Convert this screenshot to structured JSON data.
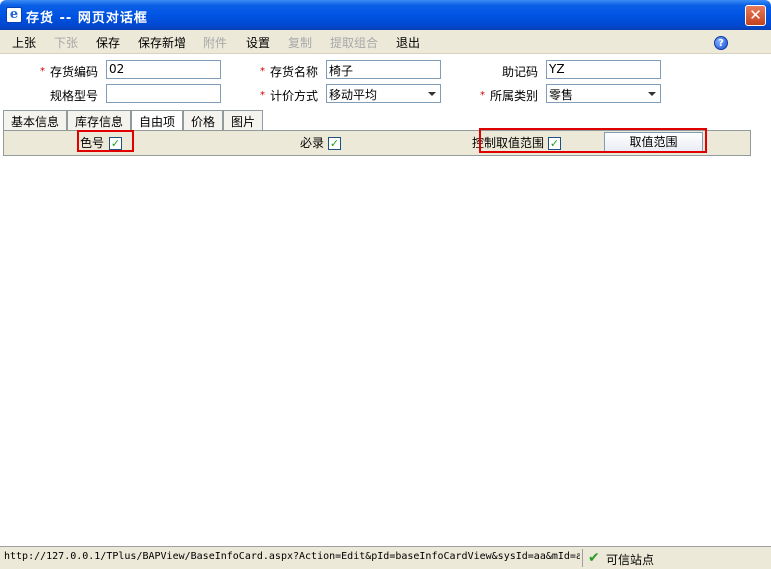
{
  "window": {
    "title": "存货 -- 网页对话框",
    "app_icon_glyph": "e",
    "close_glyph": "✕"
  },
  "toolbar": {
    "items": [
      {
        "label": "上张",
        "enabled": true
      },
      {
        "label": "下张",
        "enabled": false
      },
      {
        "label": "保存",
        "enabled": true
      },
      {
        "label": "保存新增",
        "enabled": true
      },
      {
        "label": "附件",
        "enabled": false
      },
      {
        "label": "设置",
        "enabled": true
      },
      {
        "label": "复制",
        "enabled": false
      },
      {
        "label": "提取组合",
        "enabled": false
      },
      {
        "label": "退出",
        "enabled": true
      }
    ],
    "help_glyph": "?"
  },
  "form": {
    "required_mark": "*",
    "code_label": "存货编码",
    "code_value": "02",
    "name_label": "存货名称",
    "name_value": "椅子",
    "mnemonic_label": "助记码",
    "mnemonic_value": "YZ",
    "spec_label": "规格型号",
    "spec_value": "",
    "pricing_label": "计价方式",
    "pricing_value": "移动平均",
    "category_label": "所属类别",
    "category_value": "零售"
  },
  "tabs": [
    {
      "label": "基本信息",
      "active": false
    },
    {
      "label": "库存信息",
      "active": false
    },
    {
      "label": "自由项",
      "active": true
    },
    {
      "label": "价格",
      "active": false
    },
    {
      "label": "图片",
      "active": false
    }
  ],
  "free_item": {
    "color_label": "色号",
    "color_checked": true,
    "required_label": "必录",
    "required_checked": true,
    "range_control_label": "控制取值范围",
    "range_control_checked": true,
    "range_button_label": "取值范围",
    "check_glyph": "✓"
  },
  "status": {
    "url": "http://127.0.0.1/TPlus/BAPView/BaseInfoCard.aspx?Action=Edit&pId=baseInfoCardView&sysId=aa&mId=a",
    "trust_icon_glyph": "✔",
    "trust_text": "可信站点"
  },
  "colors": {
    "titlebar": "#0054e3",
    "highlight_box": "#e00000",
    "check_mark": "#21a121",
    "required_mark": "#d40000"
  }
}
